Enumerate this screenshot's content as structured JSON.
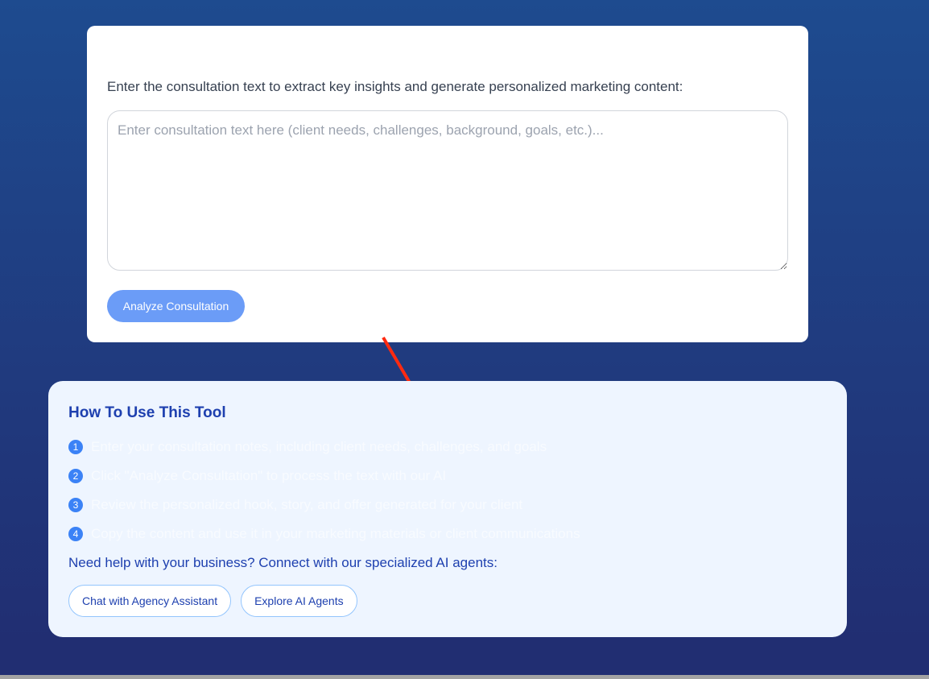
{
  "form": {
    "prompt": "Enter the consultation text to extract key insights and generate personalized marketing content:",
    "textarea_value": "",
    "textarea_placeholder": "Enter consultation text here (client needs, challenges, background, goals, etc.)...",
    "analyze_label": "Analyze Consultation"
  },
  "help": {
    "title": "How To Use This Tool",
    "steps": [
      {
        "num": "1",
        "text": "Enter your consultation notes, including client needs, challenges, and goals"
      },
      {
        "num": "2",
        "text": "Click \"Analyze Consultation\" to process the text with our AI"
      },
      {
        "num": "3",
        "text": "Review the personalized hook, story, and offer generated for your client"
      },
      {
        "num": "4",
        "text": "Copy the content and use it in your marketing materials or client communications"
      }
    ],
    "cta_text": "Need help with your business? Connect with our specialized AI agents:",
    "buttons": [
      "Chat with Agency Assistant",
      "Explore AI Agents"
    ]
  },
  "colors": {
    "accent": "#3b82f6",
    "heading": "#1e40af",
    "arrow": "#ff2a10"
  },
  "annotation": {
    "icon": "red-arrow-icon"
  }
}
